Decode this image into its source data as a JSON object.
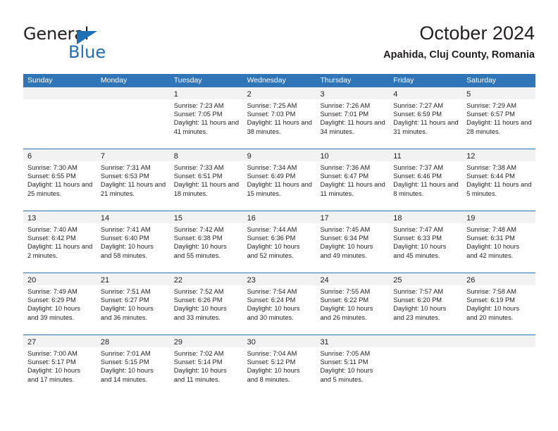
{
  "brand": {
    "name_part1": "General",
    "name_part2": "Blue",
    "triangle_icon": "blue-triangle-icon",
    "accent_color": "#1f6fb5"
  },
  "header": {
    "title": "October 2024",
    "subtitle": "Apahida, Cluj County, Romania"
  },
  "theme": {
    "header_blue": "#3075b8",
    "day_band_gray": "#f2f2f2",
    "text_color": "#231f20"
  },
  "calendar": {
    "weekdays": [
      "Sunday",
      "Monday",
      "Tuesday",
      "Wednesday",
      "Thursday",
      "Friday",
      "Saturday"
    ],
    "weeks": [
      [
        {
          "empty": true
        },
        {
          "empty": true
        },
        {
          "day": "1",
          "sunrise": "Sunrise: 7:23 AM",
          "sunset": "Sunset: 7:05 PM",
          "daylight": "Daylight: 11 hours and 41 minutes."
        },
        {
          "day": "2",
          "sunrise": "Sunrise: 7:25 AM",
          "sunset": "Sunset: 7:03 PM",
          "daylight": "Daylight: 11 hours and 38 minutes."
        },
        {
          "day": "3",
          "sunrise": "Sunrise: 7:26 AM",
          "sunset": "Sunset: 7:01 PM",
          "daylight": "Daylight: 11 hours and 34 minutes."
        },
        {
          "day": "4",
          "sunrise": "Sunrise: 7:27 AM",
          "sunset": "Sunset: 6:59 PM",
          "daylight": "Daylight: 11 hours and 31 minutes."
        },
        {
          "day": "5",
          "sunrise": "Sunrise: 7:29 AM",
          "sunset": "Sunset: 6:57 PM",
          "daylight": "Daylight: 11 hours and 28 minutes."
        }
      ],
      [
        {
          "day": "6",
          "sunrise": "Sunrise: 7:30 AM",
          "sunset": "Sunset: 6:55 PM",
          "daylight": "Daylight: 11 hours and 25 minutes."
        },
        {
          "day": "7",
          "sunrise": "Sunrise: 7:31 AM",
          "sunset": "Sunset: 6:53 PM",
          "daylight": "Daylight: 11 hours and 21 minutes."
        },
        {
          "day": "8",
          "sunrise": "Sunrise: 7:33 AM",
          "sunset": "Sunset: 6:51 PM",
          "daylight": "Daylight: 11 hours and 18 minutes."
        },
        {
          "day": "9",
          "sunrise": "Sunrise: 7:34 AM",
          "sunset": "Sunset: 6:49 PM",
          "daylight": "Daylight: 11 hours and 15 minutes."
        },
        {
          "day": "10",
          "sunrise": "Sunrise: 7:36 AM",
          "sunset": "Sunset: 6:47 PM",
          "daylight": "Daylight: 11 hours and 11 minutes."
        },
        {
          "day": "11",
          "sunrise": "Sunrise: 7:37 AM",
          "sunset": "Sunset: 6:46 PM",
          "daylight": "Daylight: 11 hours and 8 minutes."
        },
        {
          "day": "12",
          "sunrise": "Sunrise: 7:38 AM",
          "sunset": "Sunset: 6:44 PM",
          "daylight": "Daylight: 11 hours and 5 minutes."
        }
      ],
      [
        {
          "day": "13",
          "sunrise": "Sunrise: 7:40 AM",
          "sunset": "Sunset: 6:42 PM",
          "daylight": "Daylight: 11 hours and 2 minutes."
        },
        {
          "day": "14",
          "sunrise": "Sunrise: 7:41 AM",
          "sunset": "Sunset: 6:40 PM",
          "daylight": "Daylight: 10 hours and 58 minutes."
        },
        {
          "day": "15",
          "sunrise": "Sunrise: 7:42 AM",
          "sunset": "Sunset: 6:38 PM",
          "daylight": "Daylight: 10 hours and 55 minutes."
        },
        {
          "day": "16",
          "sunrise": "Sunrise: 7:44 AM",
          "sunset": "Sunset: 6:36 PM",
          "daylight": "Daylight: 10 hours and 52 minutes."
        },
        {
          "day": "17",
          "sunrise": "Sunrise: 7:45 AM",
          "sunset": "Sunset: 6:34 PM",
          "daylight": "Daylight: 10 hours and 49 minutes."
        },
        {
          "day": "18",
          "sunrise": "Sunrise: 7:47 AM",
          "sunset": "Sunset: 6:33 PM",
          "daylight": "Daylight: 10 hours and 45 minutes."
        },
        {
          "day": "19",
          "sunrise": "Sunrise: 7:48 AM",
          "sunset": "Sunset: 6:31 PM",
          "daylight": "Daylight: 10 hours and 42 minutes."
        }
      ],
      [
        {
          "day": "20",
          "sunrise": "Sunrise: 7:49 AM",
          "sunset": "Sunset: 6:29 PM",
          "daylight": "Daylight: 10 hours and 39 minutes."
        },
        {
          "day": "21",
          "sunrise": "Sunrise: 7:51 AM",
          "sunset": "Sunset: 6:27 PM",
          "daylight": "Daylight: 10 hours and 36 minutes."
        },
        {
          "day": "22",
          "sunrise": "Sunrise: 7:52 AM",
          "sunset": "Sunset: 6:26 PM",
          "daylight": "Daylight: 10 hours and 33 minutes."
        },
        {
          "day": "23",
          "sunrise": "Sunrise: 7:54 AM",
          "sunset": "Sunset: 6:24 PM",
          "daylight": "Daylight: 10 hours and 30 minutes."
        },
        {
          "day": "24",
          "sunrise": "Sunrise: 7:55 AM",
          "sunset": "Sunset: 6:22 PM",
          "daylight": "Daylight: 10 hours and 26 minutes."
        },
        {
          "day": "25",
          "sunrise": "Sunrise: 7:57 AM",
          "sunset": "Sunset: 6:20 PM",
          "daylight": "Daylight: 10 hours and 23 minutes."
        },
        {
          "day": "26",
          "sunrise": "Sunrise: 7:58 AM",
          "sunset": "Sunset: 6:19 PM",
          "daylight": "Daylight: 10 hours and 20 minutes."
        }
      ],
      [
        {
          "day": "27",
          "sunrise": "Sunrise: 7:00 AM",
          "sunset": "Sunset: 5:17 PM",
          "daylight": "Daylight: 10 hours and 17 minutes."
        },
        {
          "day": "28",
          "sunrise": "Sunrise: 7:01 AM",
          "sunset": "Sunset: 5:15 PM",
          "daylight": "Daylight: 10 hours and 14 minutes."
        },
        {
          "day": "29",
          "sunrise": "Sunrise: 7:02 AM",
          "sunset": "Sunset: 5:14 PM",
          "daylight": "Daylight: 10 hours and 11 minutes."
        },
        {
          "day": "30",
          "sunrise": "Sunrise: 7:04 AM",
          "sunset": "Sunset: 5:12 PM",
          "daylight": "Daylight: 10 hours and 8 minutes."
        },
        {
          "day": "31",
          "sunrise": "Sunrise: 7:05 AM",
          "sunset": "Sunset: 5:11 PM",
          "daylight": "Daylight: 10 hours and 5 minutes."
        },
        {
          "empty": true
        },
        {
          "empty": true
        }
      ]
    ]
  }
}
